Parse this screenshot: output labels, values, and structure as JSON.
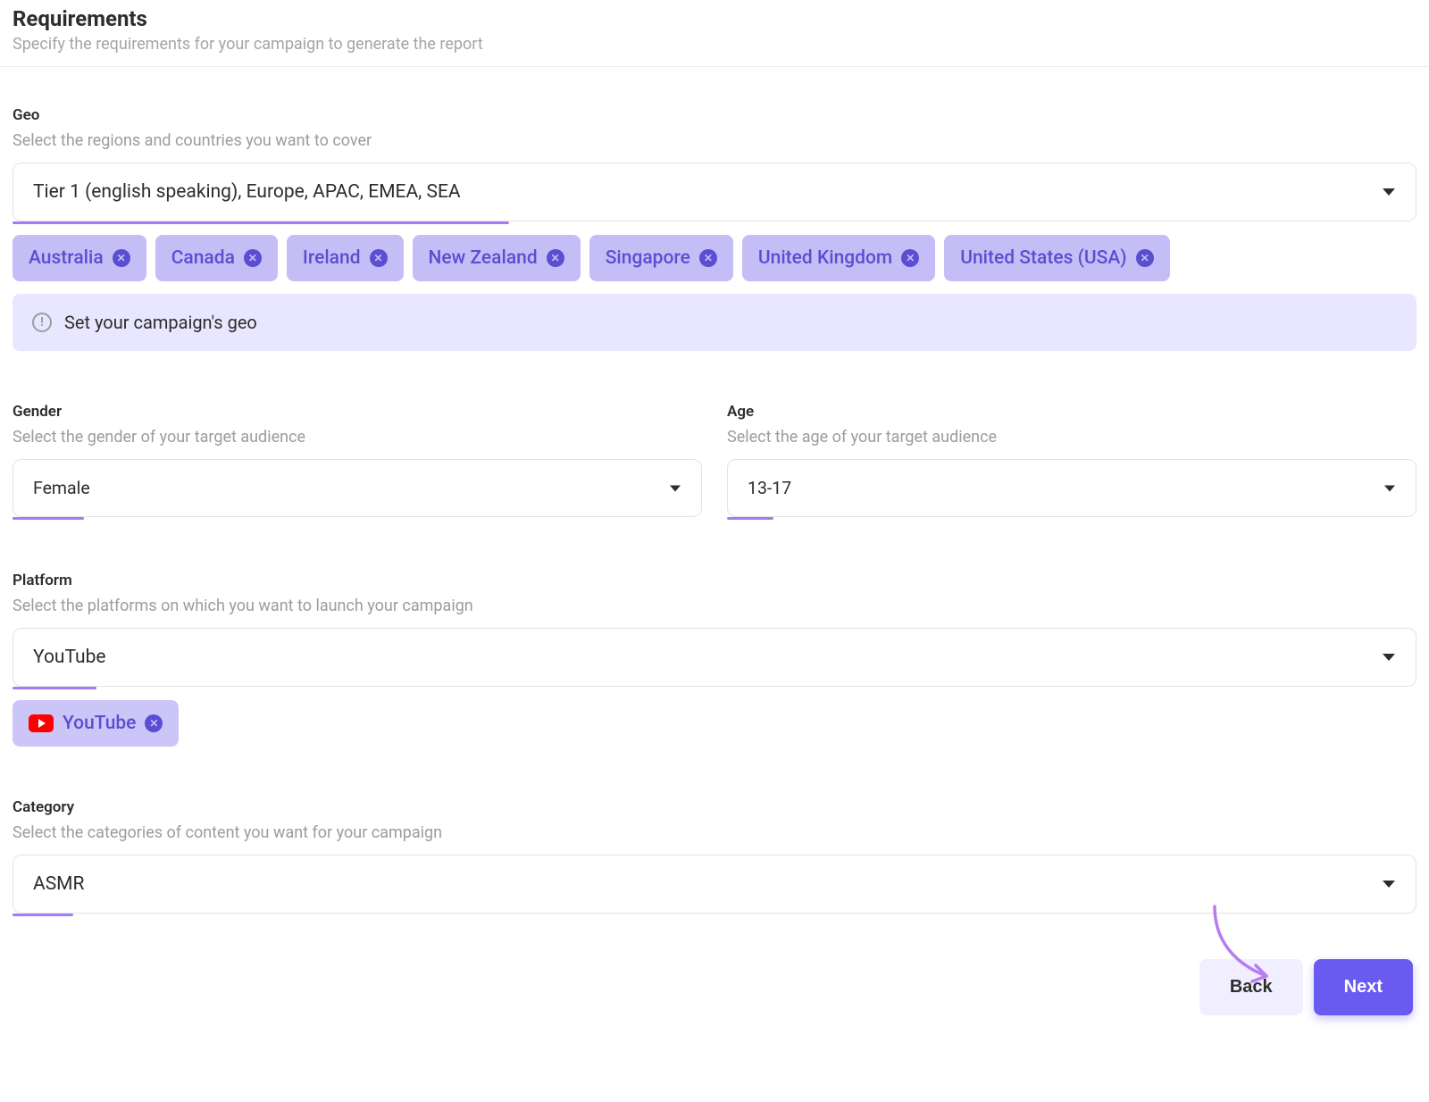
{
  "header": {
    "title": "Requirements",
    "subtitle": "Specify the requirements for your campaign to generate the report"
  },
  "geo": {
    "label": "Geo",
    "sub": "Select the regions and countries you want to cover",
    "value": "Tier 1 (english speaking), Europe, APAC, EMEA, SEA",
    "chips": [
      "Australia",
      "Canada",
      "Ireland",
      "New Zealand",
      "Singapore",
      "United Kingdom",
      "United States (USA)"
    ],
    "banner": "Set your campaign's geo"
  },
  "gender": {
    "label": "Gender",
    "sub": "Select the gender of your target audience",
    "value": "Female"
  },
  "age": {
    "label": "Age",
    "sub": "Select the age of your target audience",
    "value": "13-17"
  },
  "platform": {
    "label": "Platform",
    "sub": "Select the platforms on which you want to launch your campaign",
    "value": "YouTube",
    "chip": "YouTube"
  },
  "category": {
    "label": "Category",
    "sub": "Select the categories of content you want for your campaign",
    "value": "ASMR"
  },
  "footer": {
    "back": "Back",
    "next": "Next"
  },
  "colors": {
    "accent": "#6a5bf0",
    "underline": "#a17cf2",
    "chip_bg": "#c5bef6",
    "chip_fg": "#5a4ed1",
    "banner_bg": "#e9e7ff"
  }
}
